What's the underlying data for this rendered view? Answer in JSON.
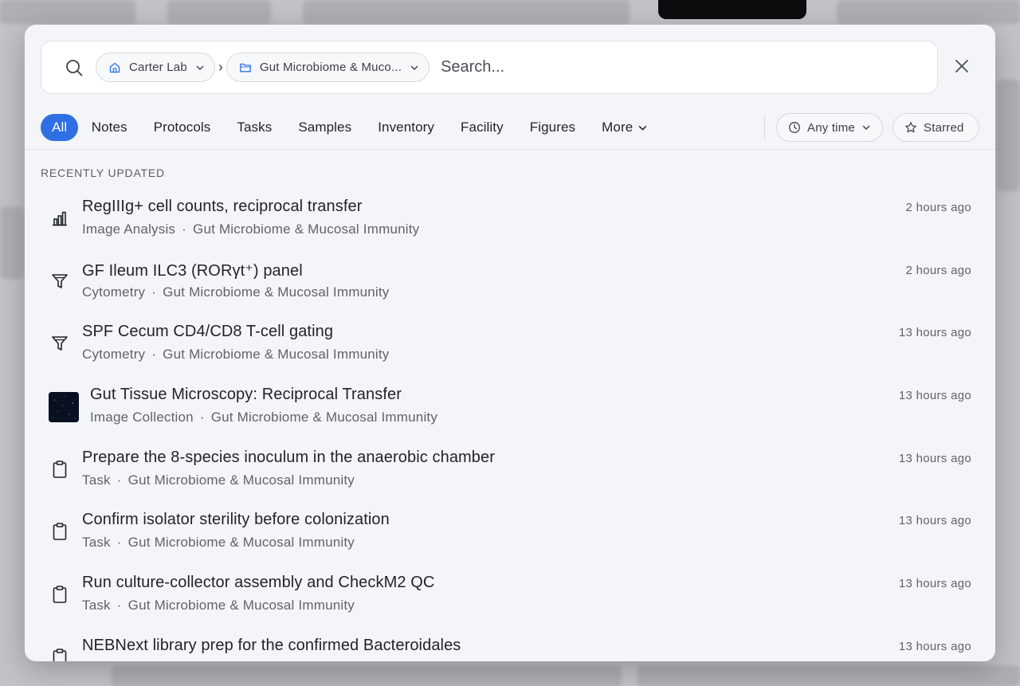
{
  "search": {
    "placeholder": "Search...",
    "breadcrumbs": [
      {
        "label": "Carter Lab",
        "icon": "home-icon"
      },
      {
        "label": "Gut Microbiome & Muco..."
      }
    ],
    "separator": "›"
  },
  "tabs": [
    {
      "label": "All",
      "active": true
    },
    {
      "label": "Notes"
    },
    {
      "label": "Protocols"
    },
    {
      "label": "Tasks"
    },
    {
      "label": "Samples"
    },
    {
      "label": "Inventory"
    },
    {
      "label": "Facility"
    },
    {
      "label": "Figures"
    },
    {
      "label": "More"
    }
  ],
  "filters": {
    "time_label": "Any time",
    "starred_label": "Starred"
  },
  "section_title": "RECENTLY UPDATED",
  "items": [
    {
      "title": "RegIIIg+ cell counts, reciprocal transfer",
      "type": "Image Analysis",
      "project": "Gut Microbiome & Mucosal Immunity",
      "time": "2 hours ago",
      "icon": "bar-chart-icon"
    },
    {
      "title": "GF Ileum ILC3 (RORγt⁺) panel",
      "type": "Cytometry",
      "project": "Gut Microbiome & Mucosal Immunity",
      "time": "2 hours ago",
      "icon": "funnel-icon"
    },
    {
      "title": "SPF Cecum CD4/CD8 T-cell gating",
      "type": "Cytometry",
      "project": "Gut Microbiome & Mucosal Immunity",
      "time": "13 hours ago",
      "icon": "funnel-icon"
    },
    {
      "title": "Gut Tissue Microscopy: Reciprocal Transfer",
      "type": "Image Collection",
      "project": "Gut Microbiome & Mucosal Immunity",
      "time": "13 hours ago",
      "icon": "image-thumbnail"
    },
    {
      "title": "Prepare the 8-species inoculum in the anaerobic chamber",
      "type": "Task",
      "project": "Gut Microbiome & Mucosal Immunity",
      "time": "13 hours ago",
      "icon": "clipboard-icon"
    },
    {
      "title": "Confirm isolator sterility before colonization",
      "type": "Task",
      "project": "Gut Microbiome & Mucosal Immunity",
      "time": "13 hours ago",
      "icon": "clipboard-icon"
    },
    {
      "title": "Run culture-collector assembly and CheckM2 QC",
      "type": "Task",
      "project": "Gut Microbiome & Mucosal Immunity",
      "time": "13 hours ago",
      "icon": "clipboard-icon"
    },
    {
      "title": "NEBNext library prep for the confirmed Bacteroidales",
      "type": "",
      "project": "",
      "time": "13 hours ago",
      "icon": "clipboard-icon"
    }
  ]
}
